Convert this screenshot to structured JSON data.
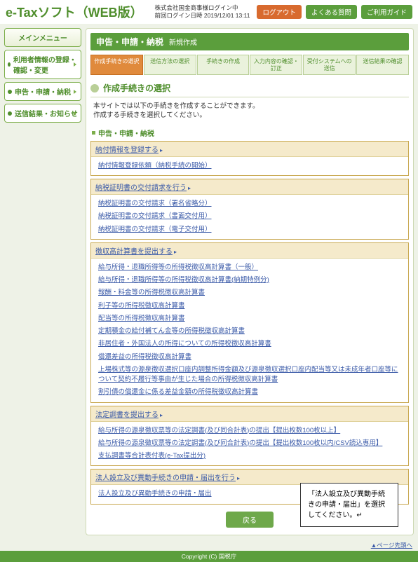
{
  "header": {
    "logo": "e-Taxソフト（WEB版）",
    "login_line1": "株式会社国金商事様ログイン中",
    "login_line2": "前回ログイン日時 2019/12/01 13:11",
    "logout": "ログアウト",
    "faq": "よくある質問",
    "guide": "ご利用ガイド"
  },
  "side": {
    "main": "メインメニュー",
    "reg": "利用者情報の登録・確認・変更",
    "filing": "申告・申請・納税",
    "result": "送信結果・お知らせ"
  },
  "title": {
    "main": "申告・申請・納税",
    "sub": "新規作成"
  },
  "steps": [
    "作成手続きの選択",
    "送信方法の選択",
    "手続きの作成",
    "入力内容の確認・訂正",
    "受付システムへの送信",
    "送信結果の確認"
  ],
  "section": "作成手続きの選択",
  "desc1": "本サイトでは以下の手続きを作成することができます。",
  "desc2": "作成する手続きを選択してください。",
  "mini": "申告・申請・納税",
  "g_pay": {
    "h": "納付情報を登録する",
    "items": [
      "納付情報登録依頼（納税手続の開始）"
    ]
  },
  "g_cert": {
    "h": "納税証明書の交付請求を行う",
    "items": [
      "納税証明書の交付請求（署名省略分）",
      "納税証明書の交付請求（書面交付用）",
      "納税証明書の交付請求（電子交付用）"
    ]
  },
  "g_tax": {
    "h": "徴収高計算書を提出する",
    "items": [
      "給与所得・退職所得等の所得税徴収高計算書（一般）",
      "給与所得・退職所得等の所得税徴収高計算書(納期特例分)",
      "報酬・料金等の所得税徴収高計算書",
      "利子等の所得税徴収高計算書",
      "配当等の所得税徴収高計算書",
      "定期積金の給付補てん金等の所得税徴収高計算書",
      "非居住者・外国法人の所得についての所得税徴収高計算書",
      "償還差益の所得税徴収高計算書",
      "上場株式等の源泉徴収選択口座内調整所得金額及び源泉徴収選択口座内配当等又は未成年者口座等について契約不履行等事由が生じた場合の所得税徴収高計算書",
      "割引債の償還金に係る差益金額の所得税徴収高計算書"
    ]
  },
  "g_rep": {
    "h": "法定調書を提出する",
    "items": [
      "給与所得の源泉徴収票等の法定調書(及び同合計表)の提出【提出枚数100枚以上】",
      "給与所得の源泉徴収票等の法定調書(及び同合計表)の提出【提出枚数100枚以内/CSV読込専用】",
      "支払調書等合計表付表(e-Tax提出分)"
    ]
  },
  "g_corp": {
    "h": "法人設立及び異動手続きの申請・届出を行う",
    "items": [
      "法人設立及び異動手続きの申請・届出"
    ]
  },
  "back": "戻る",
  "callout": "「法人設立及び異動手続きの申請・届出」を選択してください。↵",
  "pgtop": "▲ページ先頭へ",
  "footer": "Copyright (C) 国税庁"
}
